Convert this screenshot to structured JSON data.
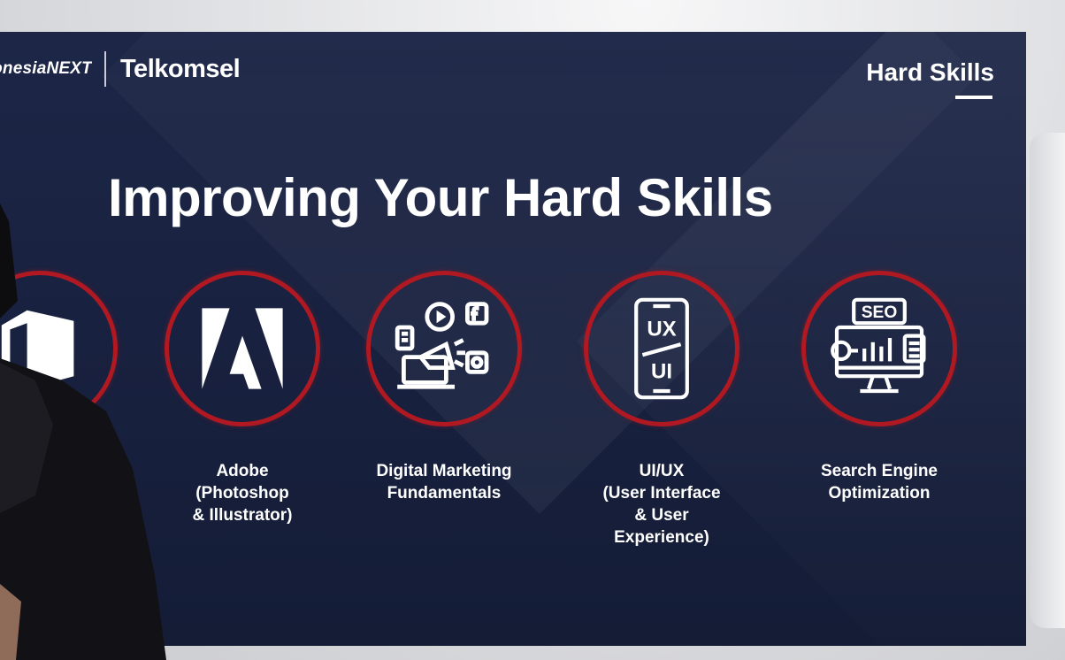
{
  "brand": {
    "partner_text": "IndonesiaNEXT",
    "name": "Telkomsel"
  },
  "slide": {
    "section_label": "Hard Skills",
    "headline": "Improving Your Hard Skills"
  },
  "skills": [
    {
      "label": ")",
      "icon": "office-icon"
    },
    {
      "label": "Adobe\n(Photoshop\n& Illustrator)",
      "icon": "adobe-icon"
    },
    {
      "label": "Digital Marketing\nFundamentals",
      "icon": "digital-marketing-icon"
    },
    {
      "label": "UI/UX\n(User Interface\n& User\nExperience)",
      "icon": "ui-ux-phone-icon"
    },
    {
      "label": "Search Engine\nOptimization",
      "icon": "seo-monitor-icon"
    }
  ],
  "colors": {
    "slide_background": "#18213f",
    "ring_accent": "#b01922",
    "text": "#ffffff"
  }
}
